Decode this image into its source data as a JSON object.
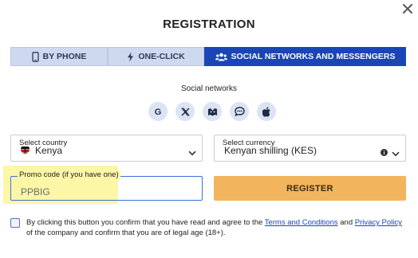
{
  "dialog": {
    "title": "REGISTRATION"
  },
  "tabs": [
    {
      "label": "BY PHONE",
      "icon": "phone-icon",
      "active": false
    },
    {
      "label": "ONE-CLICK",
      "icon": "lightning-icon",
      "active": false
    },
    {
      "label": "SOCIAL NETWORKS AND MESSENGERS",
      "icon": "users-icon",
      "active": true
    }
  ],
  "social": {
    "label": "Social networks",
    "icons": [
      "google-icon",
      "x-icon",
      "mailru-icon",
      "chat-icon",
      "apple-icon"
    ]
  },
  "country": {
    "label": "Select country",
    "value": "Kenya",
    "flag": "kenya-flag-icon"
  },
  "currency": {
    "label": "Select currency",
    "value": "Kenyan shilling (KES)"
  },
  "promo": {
    "label": "Promo code (if you have one)",
    "value": "PPBIG"
  },
  "register": {
    "label": "REGISTER"
  },
  "agreement": {
    "text_1": "By clicking this button you confirm that you have read and agree to the ",
    "terms_link": "Terms and Conditions",
    "text_2": " and ",
    "privacy_link": "Privacy Policy",
    "text_3": " of the company and confirm that you are of legal age (18+)."
  },
  "colors": {
    "active_tab": "#1a45b6",
    "inactive_tab": "#cdd9ee",
    "register_button": "#f2b45c",
    "highlight": "#fbf7a6"
  }
}
